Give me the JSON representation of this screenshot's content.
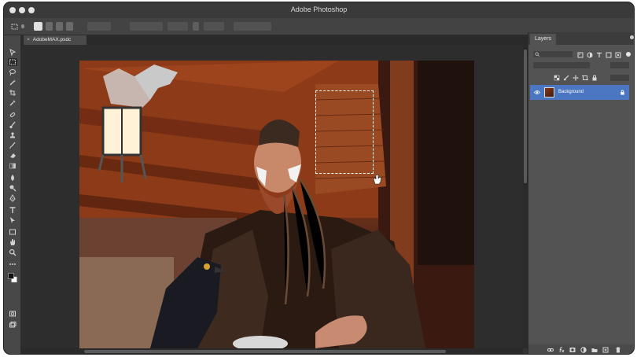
{
  "window": {
    "title": "Adobe Photoshop"
  },
  "document": {
    "tab_name": "AdobeMAX.psdc",
    "tab_close": "×"
  },
  "layers_panel": {
    "tab_label": "Layers",
    "layers": [
      {
        "name": "Background",
        "visible": true,
        "locked": true,
        "selected": true
      }
    ]
  },
  "tools": [
    "move-tool",
    "marquee-tool",
    "lasso-tool",
    "magic-wand-tool",
    "crop-tool",
    "eyedropper-tool",
    "healing-brush-tool",
    "brush-tool",
    "clone-stamp-tool",
    "history-brush-tool",
    "eraser-tool",
    "gradient-tool",
    "blur-tool",
    "dodge-tool",
    "pen-tool",
    "type-tool",
    "path-selection-tool",
    "shape-tool",
    "hand-tool",
    "zoom-tool",
    "more-tools",
    "color-swatches",
    "quick-mask",
    "screen-mode"
  ],
  "colors": {
    "accent": "#4b77c2",
    "panel": "#535353",
    "canvas_bg": "#2d2d2d"
  }
}
